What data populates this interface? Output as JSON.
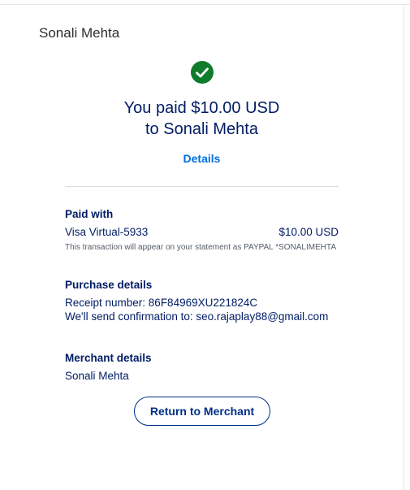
{
  "header": {
    "merchant_name": "Sonali Mehta"
  },
  "status": {
    "icon": "check-circle-icon",
    "color": "#0e7c2b"
  },
  "summary": {
    "line1": "You paid $10.00 USD",
    "line2": "to Sonali Mehta",
    "details_link": "Details"
  },
  "paid_with": {
    "title": "Paid with",
    "method": "Visa Virtual-5933",
    "amount": "$10.00 USD",
    "note": "This transaction will appear on your statement as PAYPAL *SONALIMEHTA"
  },
  "purchase_details": {
    "title": "Purchase details",
    "receipt": "Receipt number: 86F84969XU221824C",
    "confirmation": "We'll send confirmation to: seo.rajaplay88@gmail.com"
  },
  "merchant_details": {
    "title": "Merchant details",
    "name": "Sonali Mehta"
  },
  "actions": {
    "return_label": "Return to Merchant"
  }
}
